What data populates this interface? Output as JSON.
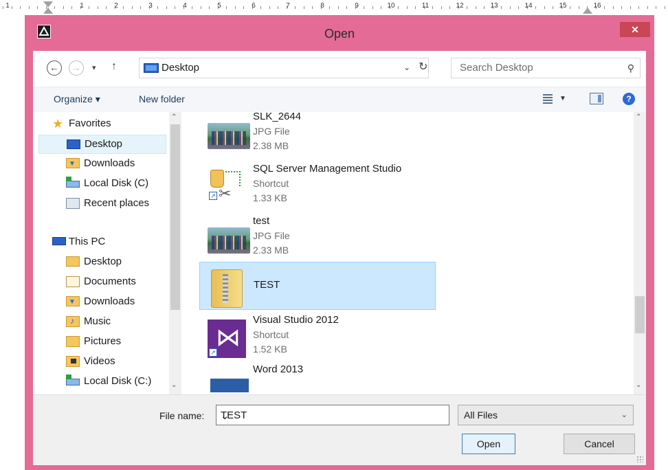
{
  "ruler": {
    "numbers": [
      "1",
      "1",
      "2",
      "3",
      "4",
      "5",
      "6",
      "7",
      "8",
      "9",
      "10",
      "11",
      "12",
      "13",
      "14",
      "15",
      "16"
    ]
  },
  "window": {
    "title": "Open",
    "close_glyph": "✕",
    "app_icon": "app-logo-icon"
  },
  "address": {
    "back_glyph": "←",
    "forward_glyph": "→",
    "recent_glyph": "▾",
    "up_glyph": "↑",
    "path": "Desktop",
    "dropdown_glyph": "⌄",
    "refresh_glyph": "↻",
    "search_placeholder": "Search Desktop",
    "search_glyph": "⚲"
  },
  "toolbar": {
    "organize_label": "Organize ▾",
    "new_folder_label": "New folder",
    "view_chevron": "▼",
    "help_glyph": "?"
  },
  "navpane": {
    "favorites_label": "Favorites",
    "favorites": [
      {
        "label": "Desktop",
        "icon": "desktop-icon",
        "selected": true
      },
      {
        "label": "Downloads",
        "icon": "downloads-icon"
      },
      {
        "label": "Local Disk (C)",
        "icon": "local-disk-icon"
      },
      {
        "label": "Recent places",
        "icon": "recent-places-icon"
      }
    ],
    "thispc_label": "This PC",
    "thispc": [
      {
        "label": "Desktop",
        "icon": "desktop-icon"
      },
      {
        "label": "Documents",
        "icon": "documents-icon"
      },
      {
        "label": "Downloads",
        "icon": "downloads-icon"
      },
      {
        "label": "Music",
        "icon": "music-icon"
      },
      {
        "label": "Pictures",
        "icon": "pictures-icon"
      },
      {
        "label": "Videos",
        "icon": "videos-icon"
      },
      {
        "label": "Local Disk (C:)",
        "icon": "local-disk-icon"
      }
    ],
    "scroll_up": "⌃",
    "scroll_down": "⌄"
  },
  "files": [
    {
      "name": "SLK_2644",
      "type": "JPG File",
      "size": "2.38 MB",
      "icon": "photo-thumbnail"
    },
    {
      "name": "SQL Server Management Studio",
      "type": "Shortcut",
      "size": "1.33 KB",
      "icon": "sql-server-icon"
    },
    {
      "name": "test",
      "type": "JPG File",
      "size": "2.33 MB",
      "icon": "photo-thumbnail"
    },
    {
      "name": "TEST",
      "type": "",
      "size": "",
      "icon": "folder-icon",
      "selected": true
    },
    {
      "name": "Visual Studio 2012",
      "type": "Shortcut",
      "size": "1.52 KB",
      "icon": "visual-studio-icon"
    },
    {
      "name": "Word 2013",
      "type": "",
      "size": "",
      "icon": "word-icon"
    }
  ],
  "filelist_scroll": {
    "up": "⌃",
    "down": "⌄"
  },
  "bottom": {
    "file_name_label": "File name:",
    "file_name_value": "TEST",
    "file_name_chevron": "⌄",
    "filter_value": "All Files",
    "filter_chevron": "⌄",
    "open_label": "Open",
    "cancel_label": "Cancel"
  },
  "colors": {
    "window_frame": "#e46b95",
    "close_button": "#c84655",
    "selection": "#cce8ff",
    "nav_selection": "#e5f3fb"
  }
}
